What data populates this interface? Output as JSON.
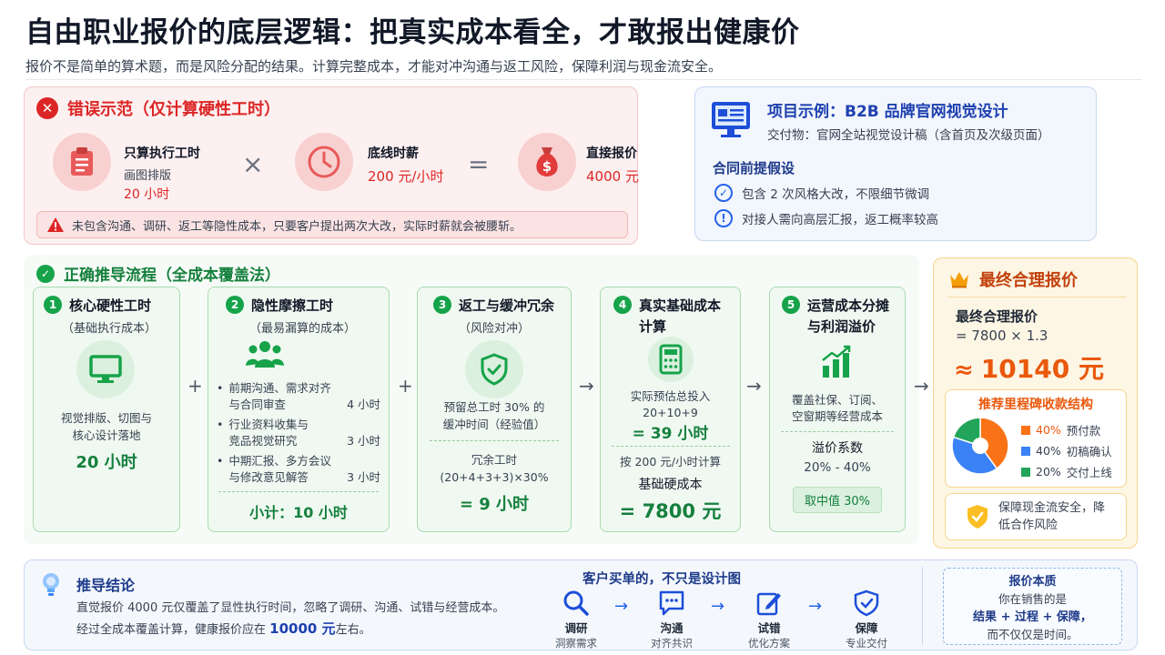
{
  "header": {
    "title": "自由职业报价的底层逻辑：把真实成本看全，才敢报出健康价",
    "subtitle": "报价不是简单的算术题，而是风险分配的结果。计算完整成本，才能对冲沟通与返工风险，保障利润与现金流安全。"
  },
  "wrong": {
    "title": "错误示范（仅计算硬性工时）",
    "items": [
      {
        "label": "只算执行工时",
        "sub": "画图排版",
        "value": "20 小时",
        "icon": "clipboard-icon"
      },
      {
        "label": "底线时薪",
        "value": "200 元/小时",
        "icon": "clock-icon"
      },
      {
        "label": "直接报价",
        "value": "4000 元",
        "icon": "money-bag-icon"
      }
    ],
    "times": "×",
    "equals": "=",
    "warning": "未包含沟通、调研、返工等隐性成本，只要客户提出两次大改，实际时薪就会被腰斩。"
  },
  "project": {
    "title": "项目示例：B2B 品牌官网视觉设计",
    "deliverable": "交付物：官网全站视觉设计稿（含首页及次级页面）",
    "assumption_title": "合同前提假设",
    "assumptions": [
      "包含 2 次风格大改，不限细节微调",
      "对接人需向高层汇报，返工概率较高"
    ]
  },
  "correct": {
    "title": "正确推导流程（全成本覆盖法）",
    "operators": [
      "+",
      "+",
      "→",
      "→",
      "→"
    ],
    "steps": [
      {
        "num": "1",
        "title": "核心硬性工时",
        "sub": "（基础执行成本）",
        "desc1": "视觉排版、切图与",
        "desc2": "核心设计落地",
        "value": "20 小时",
        "icon": "monitor-icon"
      },
      {
        "num": "2",
        "title": "隐性摩擦工时",
        "sub": "（最易漏算的成本）",
        "icon": "people-icon",
        "items": [
          {
            "l1": "前期沟通、需求对齐",
            "l2": "与合同审查",
            "hours": "4 小时"
          },
          {
            "l1": "行业资料收集与",
            "l2": "竞品视觉研究",
            "hours": "3 小时"
          },
          {
            "l1": "中期汇报、多方会议",
            "l2": "与修改意见解答",
            "hours": "3 小时"
          }
        ],
        "subtotal": "小计：10 小时"
      },
      {
        "num": "3",
        "title": "返工与缓冲冗余",
        "sub": "（风险对冲）",
        "icon": "shield-check-icon",
        "desc1": "预留总工时 30% 的",
        "desc2": "缓冲时间（经验值）",
        "formula_label": "冗余工时",
        "formula": "(20+4+3+3)×30%",
        "value": "= 9 小时"
      },
      {
        "num": "4",
        "title1": "真实基础成本",
        "title2": "计算",
        "icon": "calculator-icon",
        "desc1": "实际预估总投入",
        "desc2": "20+10+9",
        "hours": "= 39 小时",
        "rate": "按 200 元/小时计算",
        "base_label": "基础硬成本",
        "base_value": "= 7800 元"
      },
      {
        "num": "5",
        "title1": "运营成本分摊",
        "title2": "与利润溢价",
        "icon": "bar-chart-icon",
        "desc1": "覆盖社保、订阅、",
        "desc2": "空窗期等经营成本",
        "premium_label": "溢价系数",
        "premium_range": "20% - 40%",
        "pick": "取中值 30%"
      }
    ]
  },
  "final": {
    "title": "最终合理报价",
    "label": "最终合理报价",
    "formula": "= 7800 × 1.3",
    "approx": "≈",
    "value": "10140 元",
    "milestone_title": "推荐里程碑收款结构",
    "guarantee": "保障现金流安全，降低合作风险"
  },
  "chart_data": {
    "type": "pie",
    "title": "推荐里程碑收款结构",
    "categories": [
      "预付款",
      "初稿确认",
      "交付上线"
    ],
    "values": [
      40,
      40,
      20
    ],
    "labels": [
      "40%",
      "40%",
      "20%"
    ],
    "colors": [
      "#f97316",
      "#3b82f6",
      "#22a55a"
    ]
  },
  "conclusion": {
    "title": "推导结论",
    "line1": "直觉报价 4000 元仅覆盖了显性执行时间，忽略了调研、沟通、试错与经营成本。",
    "line2a": "经过全成本覆盖计算，健康报价应在 ",
    "line2b": "10000 元",
    "line2c": "左右。",
    "flow_title": "客户买单的，不只是设计图",
    "flow": [
      {
        "label": "调研",
        "sub": "洞察需求",
        "icon": "search-icon"
      },
      {
        "label": "沟通",
        "sub": "对齐共识",
        "icon": "chat-icon"
      },
      {
        "label": "试错",
        "sub": "优化方案",
        "icon": "edit-icon"
      },
      {
        "label": "保障",
        "sub": "专业交付",
        "icon": "shield-icon"
      }
    ],
    "essence_title": "报价本质",
    "essence_l1": "你在销售的是",
    "essence_l2": "结果 + 过程 + 保障，",
    "essence_l3": "而不仅仅是时间。"
  }
}
